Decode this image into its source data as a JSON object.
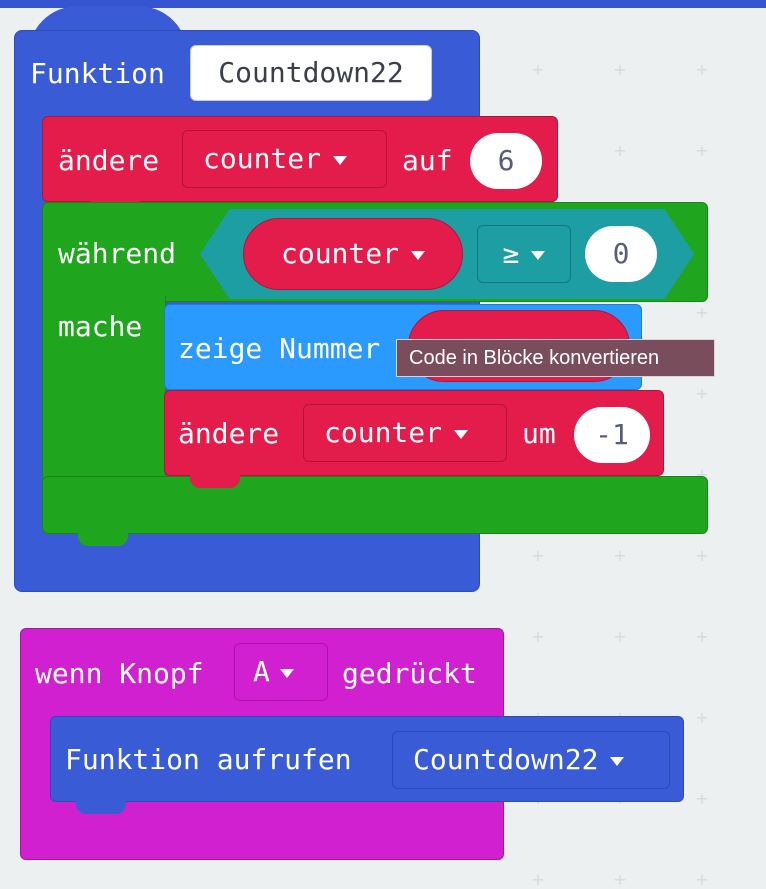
{
  "workspace": {
    "background": "#ecf0f1"
  },
  "function_block": {
    "keyword": "Funktion",
    "name": "Countdown22",
    "color": "#3a5bd6"
  },
  "set_block": {
    "keyword": "ändere",
    "variable": "counter",
    "to_label": "auf",
    "value": "6",
    "color": "#e31c4c"
  },
  "while_block": {
    "keyword": "während",
    "do_label": "mache",
    "condition": {
      "variable": "counter",
      "operator": "≥",
      "value": "0"
    },
    "color": "#20a61e"
  },
  "show_number_block": {
    "label": "zeige Nummer",
    "color": "#2b9aff"
  },
  "change_block": {
    "keyword": "ändere",
    "variable": "counter",
    "by_label": "um",
    "value": "-1"
  },
  "tooltip": {
    "text": "Code in Blöcke konvertieren"
  },
  "button_block": {
    "prefix": "wenn Knopf",
    "button": "A",
    "suffix": "gedrückt",
    "color": "#d020d0"
  },
  "call_block": {
    "label": "Funktion aufrufen",
    "function": "Countdown22"
  }
}
